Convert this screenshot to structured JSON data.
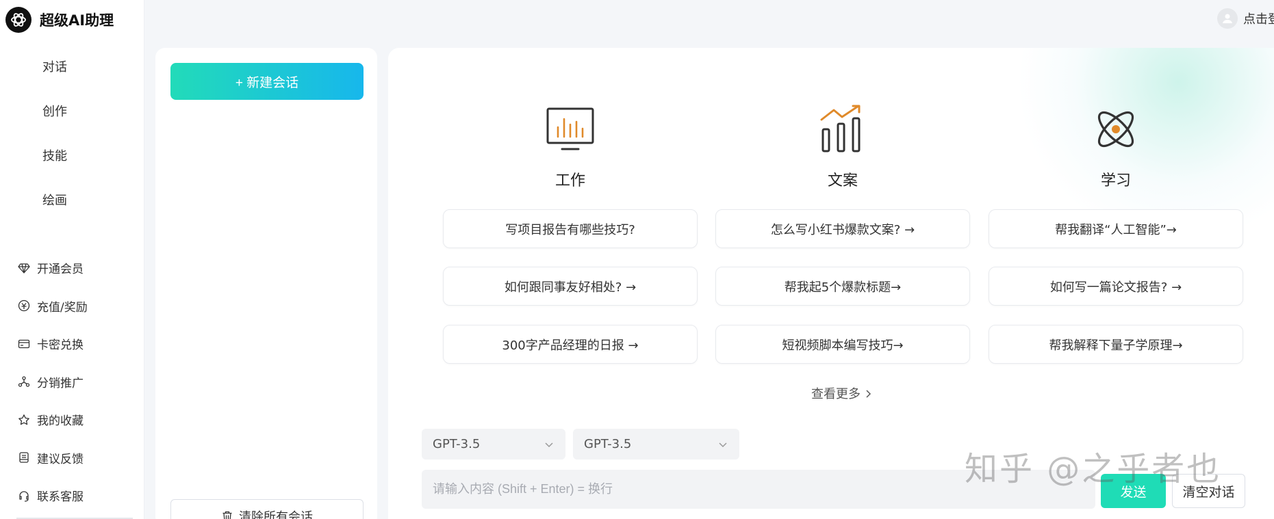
{
  "brand": {
    "title": "超级AI助理"
  },
  "nav": {
    "top": [
      {
        "label": "对话"
      },
      {
        "label": "创作"
      },
      {
        "label": "技能"
      },
      {
        "label": "绘画"
      }
    ],
    "bottom": [
      {
        "label": "开通会员",
        "icon": "diamond-icon"
      },
      {
        "label": "充值/奖励",
        "icon": "recharge-icon"
      },
      {
        "label": "卡密兑换",
        "icon": "card-icon"
      },
      {
        "label": "分销推广",
        "icon": "share-network-icon"
      },
      {
        "label": "我的收藏",
        "icon": "star-icon"
      },
      {
        "label": "建议反馈",
        "icon": "feedback-icon"
      },
      {
        "label": "联系客服",
        "icon": "headset-icon"
      }
    ]
  },
  "conversations": {
    "new_chat_label": "+ 新建会话",
    "clear_all_label": "清除所有会话"
  },
  "header": {
    "login_label": "点击登"
  },
  "categories": [
    {
      "title": "工作",
      "icon": "monitor-chart-icon",
      "prompts": [
        "写项目报告有哪些技巧?",
        "如何跟同事友好相处? →",
        "300字产品经理的日报 →"
      ]
    },
    {
      "title": "文案",
      "icon": "bar-trend-icon",
      "prompts": [
        "怎么写小红书爆款文案? →",
        "帮我起5个爆款标题→",
        "短视频脚本编写技巧→"
      ]
    },
    {
      "title": "学习",
      "icon": "atom-icon",
      "prompts": [
        "帮我翻译“人工智能”→",
        "如何写一篇论文报告? →",
        "帮我解释下量子学原理→"
      ]
    }
  ],
  "view_more_label": "查看更多",
  "model_selects": [
    {
      "value": "GPT-3.5"
    },
    {
      "value": "GPT-3.5"
    }
  ],
  "composer": {
    "placeholder": "请输入内容 (Shift + Enter) = 换行",
    "send_label": "发送",
    "clear_label": "清空对话"
  },
  "watermark": "知乎 @之乎者也",
  "colors": {
    "accent": "#1fdcb6",
    "gradient_start": "#22dbb9",
    "gradient_end": "#17b7ec",
    "icon_orange": "#e08a2a",
    "icon_dark": "#333333"
  }
}
